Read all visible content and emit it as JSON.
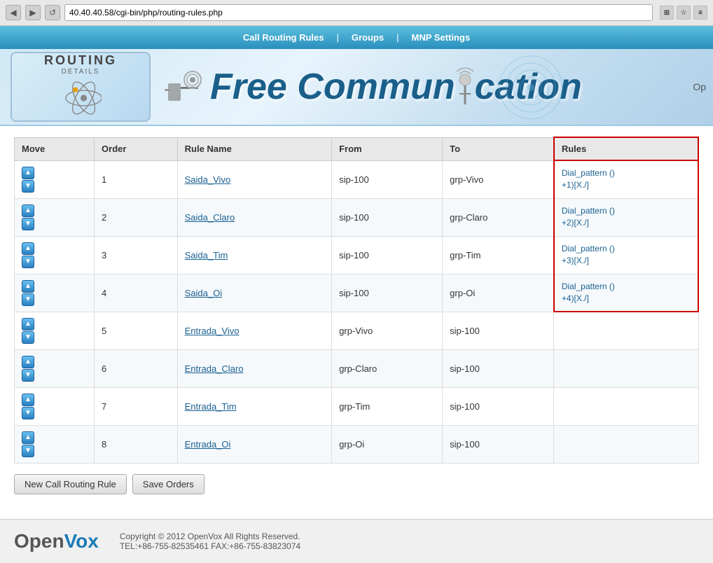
{
  "browser": {
    "url": "40.40.40.58/cgi-bin/php/routing-rules.php",
    "back_label": "◀",
    "forward_label": "▶",
    "refresh_label": "↺"
  },
  "topnav": {
    "items": [
      {
        "label": "Call Routing Rules",
        "id": "call-routing-rules"
      },
      {
        "separator": "|"
      },
      {
        "label": "Groups",
        "id": "groups"
      },
      {
        "separator": "|"
      },
      {
        "label": "MNP Settings",
        "id": "mnp-settings"
      }
    ]
  },
  "banner": {
    "badge_title": "ROUTING",
    "badge_subtitle": "DETAILS",
    "title": "Free Commun",
    "title2": "cation",
    "right_text": "Op"
  },
  "table": {
    "columns": [
      "Move",
      "Order",
      "Rule Name",
      "From",
      "To",
      "Rules"
    ],
    "rows": [
      {
        "order": "1",
        "rule_name": "Saida_Vivo",
        "from": "sip-100",
        "to": "grp-Vivo",
        "rules": "Dial_pattern ()+1)[X./]"
      },
      {
        "order": "2",
        "rule_name": "Saida_Claro",
        "from": "sip-100",
        "to": "grp-Claro",
        "rules": "Dial_pattern ()+2)[X./]"
      },
      {
        "order": "3",
        "rule_name": "Saida_Tim",
        "from": "sip-100",
        "to": "grp-Tim",
        "rules": "Dial_pattern ()+3)[X./]"
      },
      {
        "order": "4",
        "rule_name": "Saida_Oi",
        "from": "sip-100",
        "to": "grp-Oi",
        "rules": "Dial_pattern ()+4)[X./]"
      },
      {
        "order": "5",
        "rule_name": "Entrada_Vivo",
        "from": "grp-Vivo",
        "to": "sip-100",
        "rules": ""
      },
      {
        "order": "6",
        "rule_name": "Entrada_Claro",
        "from": "grp-Claro",
        "to": "sip-100",
        "rules": ""
      },
      {
        "order": "7",
        "rule_name": "Entrada_Tim",
        "from": "grp-Tim",
        "to": "sip-100",
        "rules": ""
      },
      {
        "order": "8",
        "rule_name": "Entrada_Oi",
        "from": "grp-Oi",
        "to": "sip-100",
        "rules": ""
      }
    ],
    "rules_detail": [
      {
        "row": 1,
        "text": "Dial_pattern ()+1)[X./]"
      },
      {
        "row": 2,
        "text": "Dial_pattern ()+2)[X./]"
      },
      {
        "row": 3,
        "text": "Dial_pattern ()+3)[X./]"
      },
      {
        "row": 4,
        "text": "Dial_pattern ()+4)[X./]"
      }
    ]
  },
  "buttons": {
    "new_rule": "New Call Routing Rule",
    "save_orders": "Save Orders"
  },
  "footer": {
    "logo_open": "Open",
    "logo_vox": "Vox",
    "copyright": "Copyright © 2012 OpenVox All Rights Reserved.",
    "contact": "TEL:+86-755-82535461 FAX:+86-755-83823074"
  }
}
